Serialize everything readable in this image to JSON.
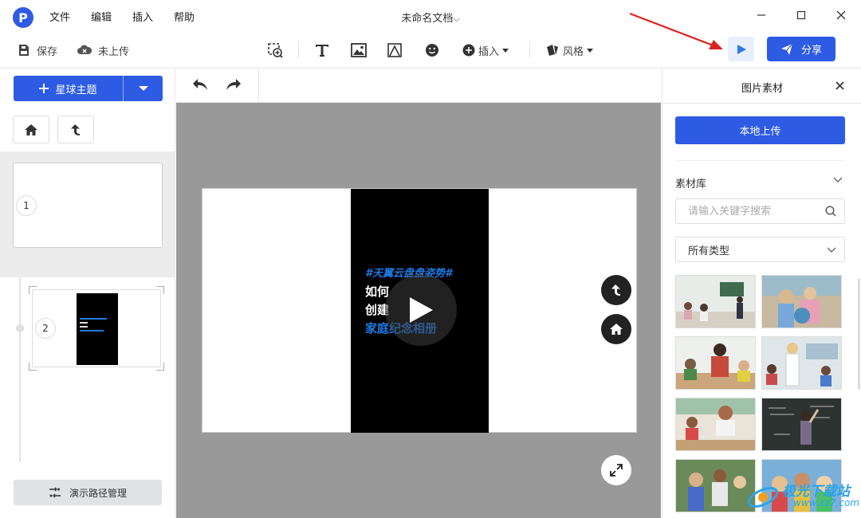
{
  "app": {
    "logo_letter": "P",
    "menu": [
      "文件",
      "编辑",
      "插入",
      "帮助"
    ],
    "document_title": "未命名文档"
  },
  "toolbar": {
    "save_label": "保存",
    "upload_status": "未上传",
    "insert_label": "插入",
    "style_label": "风格",
    "share_label": "分享"
  },
  "left_panel": {
    "theme_button": "星球主题",
    "slides": [
      {
        "number": "1"
      },
      {
        "number": "2"
      }
    ],
    "path_manage_button": "演示路径管理"
  },
  "canvas": {
    "video_text": {
      "line1": "#天翼云盘盘姿势#",
      "line2": "如何",
      "line3": "创建",
      "line4": "家庭纪念相册"
    }
  },
  "right_panel": {
    "title": "图片素材",
    "upload_button": "本地上传",
    "library_label": "素材库",
    "search_placeholder": "请输入关键字搜索",
    "type_select": "所有类型",
    "image_count": 8
  },
  "watermark": {
    "text": "极光下载站",
    "url": "www.xz7.com"
  },
  "colors": {
    "accent": "#2d5be3",
    "canvas_bg": "#999999",
    "video_text_blue": "#1e7be6",
    "annotation_red": "#e02020"
  }
}
